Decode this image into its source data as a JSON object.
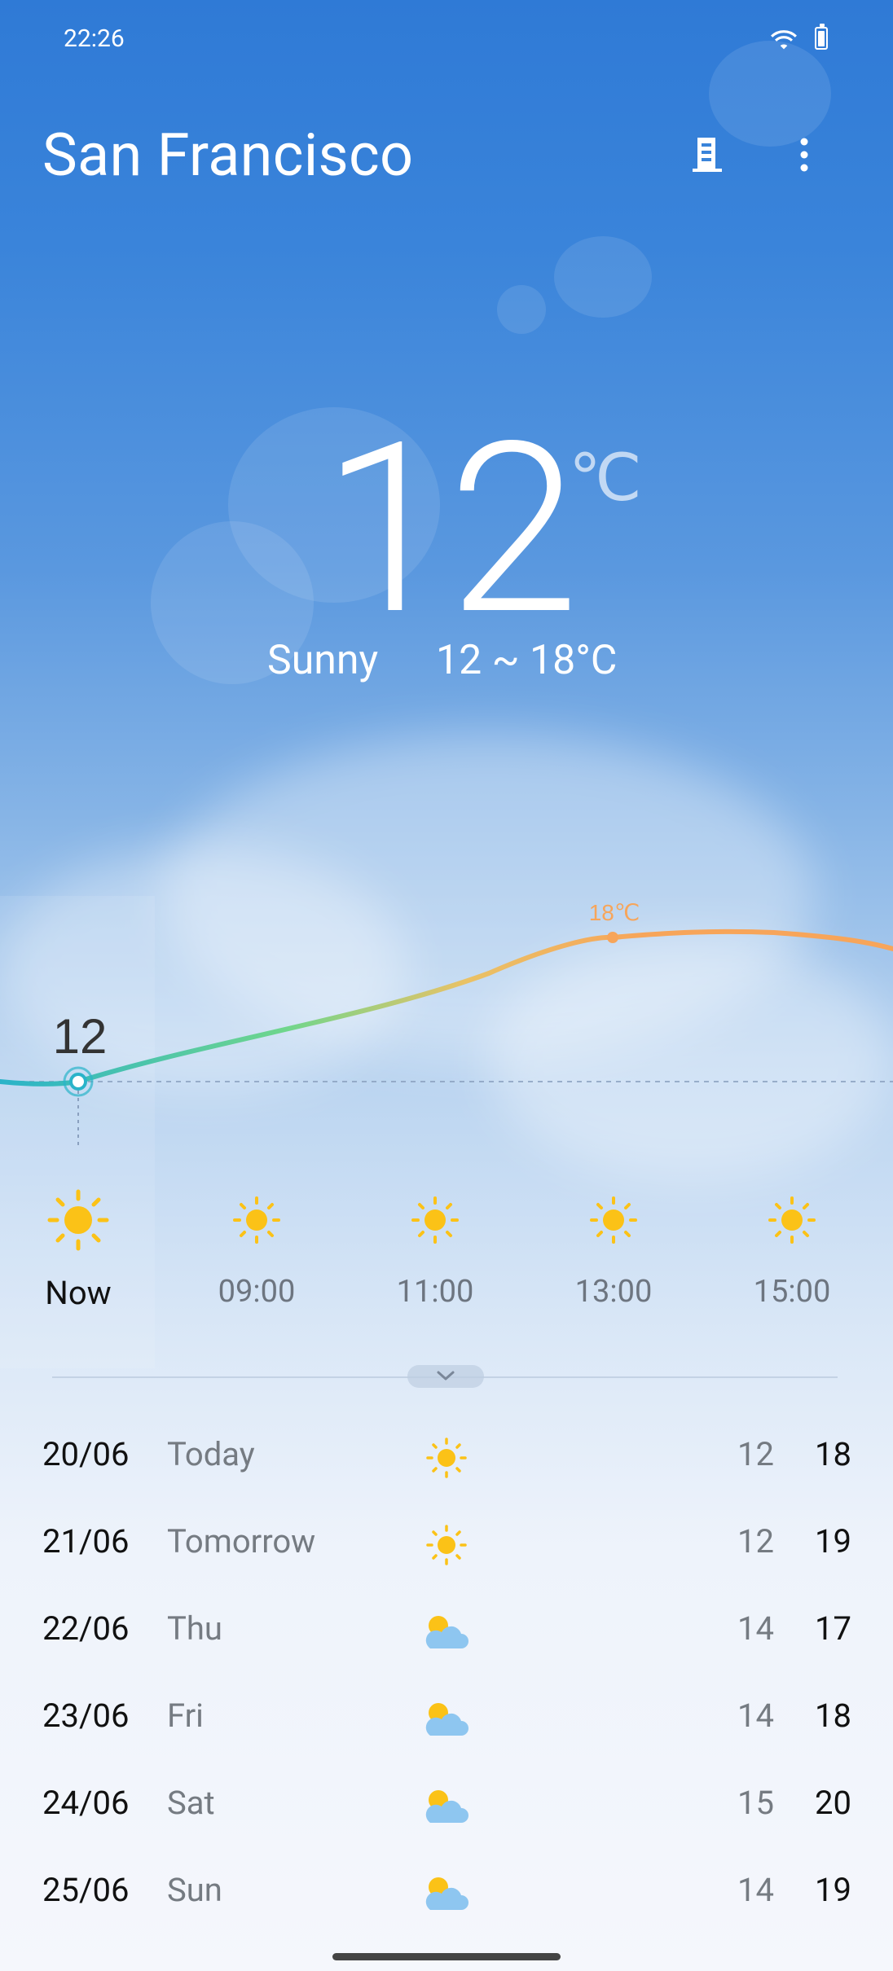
{
  "status_bar": {
    "time": "22:26"
  },
  "header": {
    "city": "San Francisco"
  },
  "current": {
    "temperature": "12",
    "unit": "℃",
    "condition": "Sunny",
    "range": "12 ~ 18°C"
  },
  "hourly_chart": {
    "current_value": "12",
    "peak_label": "18℃"
  },
  "hourly": [
    {
      "label": "Now",
      "icon": "sun-icon"
    },
    {
      "label": "09:00",
      "icon": "sun-icon"
    },
    {
      "label": "11:00",
      "icon": "sun-icon"
    },
    {
      "label": "13:00",
      "icon": "sun-icon"
    },
    {
      "label": "15:00",
      "icon": "sun-icon"
    }
  ],
  "daily": [
    {
      "date": "20/06",
      "day": "Today",
      "icon": "sun-icon",
      "low": "12",
      "high": "18"
    },
    {
      "date": "21/06",
      "day": "Tomorrow",
      "icon": "sun-icon",
      "low": "12",
      "high": "19"
    },
    {
      "date": "22/06",
      "day": "Thu",
      "icon": "partly-cloudy-icon",
      "low": "14",
      "high": "17"
    },
    {
      "date": "23/06",
      "day": "Fri",
      "icon": "partly-cloudy-icon",
      "low": "14",
      "high": "18"
    },
    {
      "date": "24/06",
      "day": "Sat",
      "icon": "partly-cloudy-icon",
      "low": "15",
      "high": "20"
    },
    {
      "date": "25/06",
      "day": "Sun",
      "icon": "partly-cloudy-icon",
      "low": "14",
      "high": "19"
    }
  ],
  "colors": {
    "sky_top": "#2f7ad6",
    "sun": "#fbc217",
    "curve_start": "#2ab3c9",
    "curve_mid": "#6fd68c",
    "curve_end": "#f7a55a"
  }
}
